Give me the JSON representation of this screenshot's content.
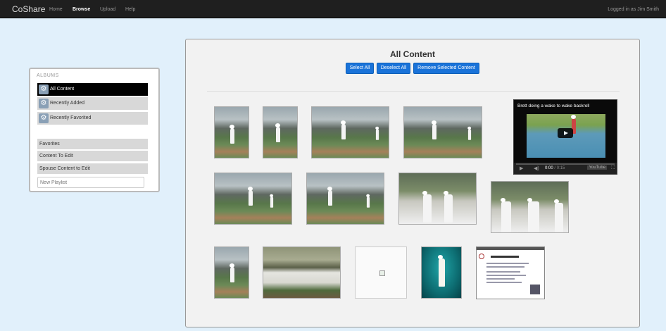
{
  "app": {
    "title": "CoShare"
  },
  "nav": {
    "items": [
      "Home",
      "Browse",
      "Upload",
      "Help"
    ],
    "active": "Browse"
  },
  "user": {
    "status": "Logged in as Jim Smith"
  },
  "albums": {
    "heading": "ALBUMS",
    "items": [
      "All Content",
      "Recently Added",
      "Recently Favorited"
    ],
    "selected": "All Content",
    "playlists": [
      "Favorites",
      "Content To Edit",
      "Spouse Content to Edit"
    ],
    "new_playlist_placeholder": "New Playlist"
  },
  "content": {
    "title": "All Content",
    "buttons": {
      "select_all": "Select All",
      "deselect_all": "Deselect All",
      "remove": "Remove Selected Content"
    },
    "video": {
      "title": "Brett doing a wake to wake backroll",
      "current_time": "0:00",
      "total_time": "0:15",
      "logo": "YouTube"
    }
  },
  "colors": {
    "accent": "#1a73d9",
    "topbar": "#1f1f1f",
    "page_bg": "#e1f0fb",
    "selected_album": "#000000"
  }
}
